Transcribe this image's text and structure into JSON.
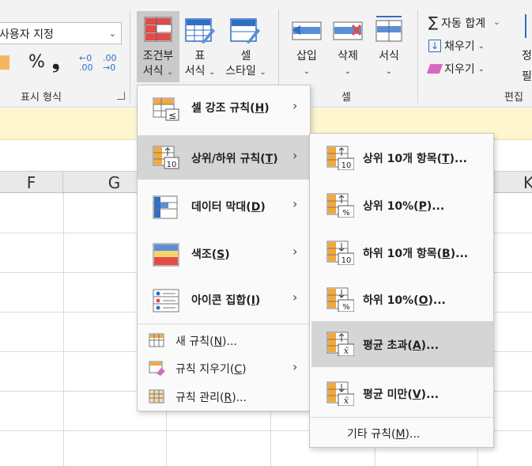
{
  "ribbon": {
    "number_format": {
      "value": "사용자 지정"
    },
    "number_group_label": "표시 형식",
    "percent_symbol": "%",
    "comma_symbol": "❟",
    "inc_decimal": "←0 .00",
    "dec_decimal": ".00 →0",
    "conditional_formatting": {
      "line1": "조건부",
      "line2": "서식"
    },
    "format_as_table": {
      "line1": "표",
      "line2": "서식"
    },
    "cell_styles": {
      "line1": "셀",
      "line2": "스타일"
    },
    "insert": "삽입",
    "delete": "삭제",
    "format": "서식",
    "cells_group_label": "셀",
    "autosum": "자동 합계",
    "fill": "채우기",
    "clear": "지우기",
    "editing_group_label": "편집",
    "sort_partial": "정",
    "find_partial": "필"
  },
  "grid": {
    "columns": [
      "F",
      "G",
      "K"
    ]
  },
  "cf_menu": {
    "items": [
      {
        "label": "셀 강조 규칙",
        "key": "H"
      },
      {
        "label": "상위/하위 규칙",
        "key": "T"
      },
      {
        "label": "데이터 막대",
        "key": "D"
      },
      {
        "label": "색조",
        "key": "S"
      },
      {
        "label": "아이콘 집합",
        "key": "I"
      }
    ],
    "new_rule": {
      "label": "새 규칙",
      "key": "N",
      "suffix": "..."
    },
    "clear_rules": {
      "label": "규칙 지우기",
      "key": "C"
    },
    "manage_rules": {
      "label": "규칙 관리",
      "key": "R",
      "suffix": "..."
    }
  },
  "topbottom_menu": {
    "items": [
      {
        "label": "상위 10개 항목",
        "key": "T",
        "suffix": "...",
        "badge": "10"
      },
      {
        "label": "상위 10%",
        "key": "P",
        "suffix": "...",
        "badge": "%"
      },
      {
        "label": "하위 10개 항목",
        "key": "B",
        "suffix": "...",
        "badge": "10"
      },
      {
        "label": "하위 10%",
        "key": "O",
        "suffix": "...",
        "badge": "%"
      },
      {
        "label": "평균 초과",
        "key": "A",
        "suffix": "...",
        "badge": "x̄"
      },
      {
        "label": "평균 미만",
        "key": "V",
        "suffix": "...",
        "badge": "x̄"
      }
    ],
    "more_rules": {
      "label": "기타 규칙",
      "key": "M",
      "suffix": "..."
    }
  },
  "colors": {
    "accent_blue": "#2f6fc4",
    "accent_red": "#e34b4b",
    "accent_orange": "#f4a83c",
    "highlight": "#d5d5d5"
  }
}
